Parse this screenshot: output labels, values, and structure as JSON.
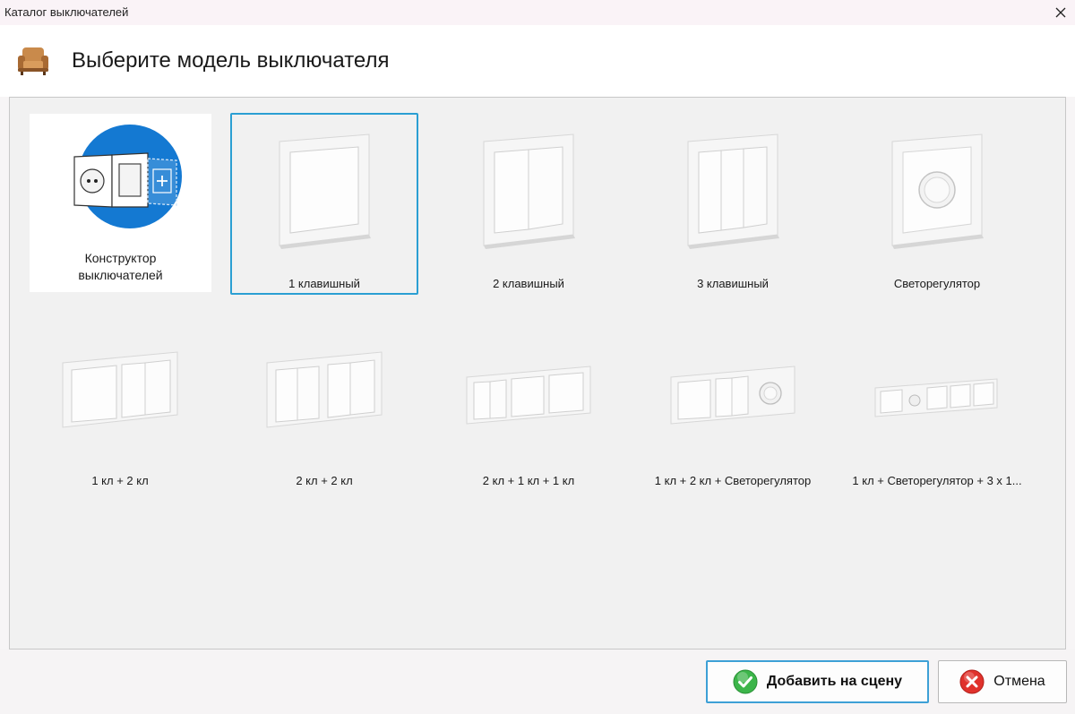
{
  "window": {
    "title": "Каталог выключателей"
  },
  "header": {
    "title": "Выберите модель выключателя"
  },
  "catalog": {
    "constructor_label": "Конструктор выключателей",
    "items": [
      {
        "label": "1 клавишный"
      },
      {
        "label": "2 клавишный"
      },
      {
        "label": "3 клавишный"
      },
      {
        "label": "Светорегулятор"
      },
      {
        "label": "1 кл + 2 кл"
      },
      {
        "label": "2 кл + 2 кл"
      },
      {
        "label": "2 кл + 1 кл + 1 кл"
      },
      {
        "label": "1 кл + 2 кл + Светорегулятор"
      },
      {
        "label": "1 кл + Светорегулятор + 3 x 1..."
      }
    ],
    "selected_index": 0
  },
  "footer": {
    "add_label": "Добавить на сцену",
    "cancel_label": "Отмена"
  },
  "icons": {
    "close": "close-icon",
    "sofa": "sofa-icon",
    "constructor": "switch-constructor-icon",
    "add": "green-check-icon",
    "cancel": "red-x-icon"
  },
  "colors": {
    "accent": "#2b9fd3",
    "constructor_circle": "#1479d2",
    "add_icon": "#3cb54a",
    "cancel_icon": "#e0322c"
  }
}
